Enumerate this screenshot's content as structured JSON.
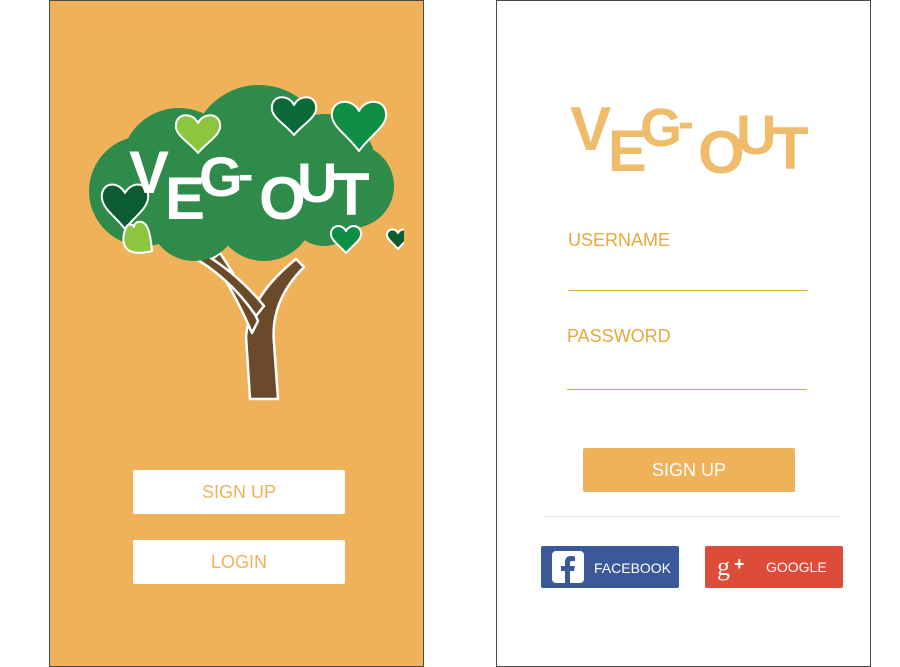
{
  "left_screen": {
    "logo": {
      "letters": [
        "V",
        "E",
        "G",
        "-",
        "O",
        "U",
        "T"
      ]
    },
    "buttons": {
      "signup": "SIGN UP",
      "login": "LOGIN"
    }
  },
  "right_screen": {
    "logo": {
      "letters": [
        "V",
        "E",
        "G",
        "-",
        "O",
        "U",
        "T"
      ]
    },
    "username_label": "USERNAME",
    "password_label": "PASSWORD",
    "signup_button": "SIGN UP",
    "social": {
      "facebook": {
        "label": "FACEBOOK",
        "icon": "facebook-icon",
        "color": "#3b5998"
      },
      "google": {
        "label": "GOOGLE",
        "icon": "google-plus-icon",
        "color": "#dd4b39"
      }
    }
  },
  "colors": {
    "brand_orange": "#efb25a",
    "logo_light_orange": "#efbc6c",
    "tree_green": "#2e8b4a",
    "trunk_brown": "#6b4a2b"
  }
}
